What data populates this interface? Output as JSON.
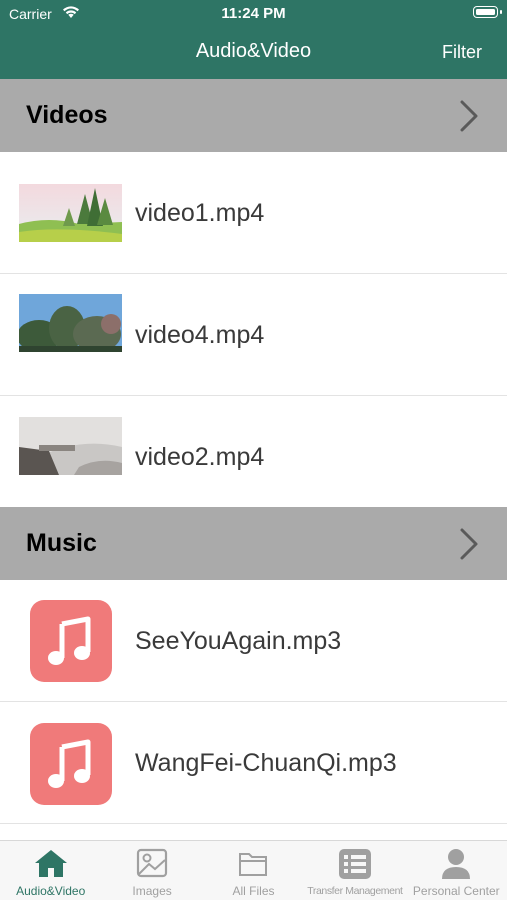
{
  "status_bar": {
    "carrier": "Carrier",
    "time": "11:24 PM"
  },
  "nav": {
    "title": "Audio&Video",
    "filter": "Filter"
  },
  "colors": {
    "accent": "#2e7565",
    "section_bg": "#aaaaaa",
    "music_icon_bg": "#f07a7a"
  },
  "sections": {
    "videos": {
      "title": "Videos",
      "items": [
        {
          "name": "video1.mp4"
        },
        {
          "name": "video4.mp4"
        },
        {
          "name": "video2.mp4"
        }
      ]
    },
    "music": {
      "title": "Music",
      "items": [
        {
          "name": "SeeYouAgain.mp3"
        },
        {
          "name": "WangFei-ChuanQi.mp3"
        }
      ]
    }
  },
  "tabbar": {
    "tabs": [
      {
        "label": "Audio&Video",
        "icon": "home-icon",
        "active": true
      },
      {
        "label": "Images",
        "icon": "image-icon",
        "active": false
      },
      {
        "label": "All Files",
        "icon": "folder-icon",
        "active": false
      },
      {
        "label": "Transfer Management",
        "icon": "list-icon",
        "active": false
      },
      {
        "label": "Personal Center",
        "icon": "person-icon",
        "active": false
      }
    ]
  }
}
